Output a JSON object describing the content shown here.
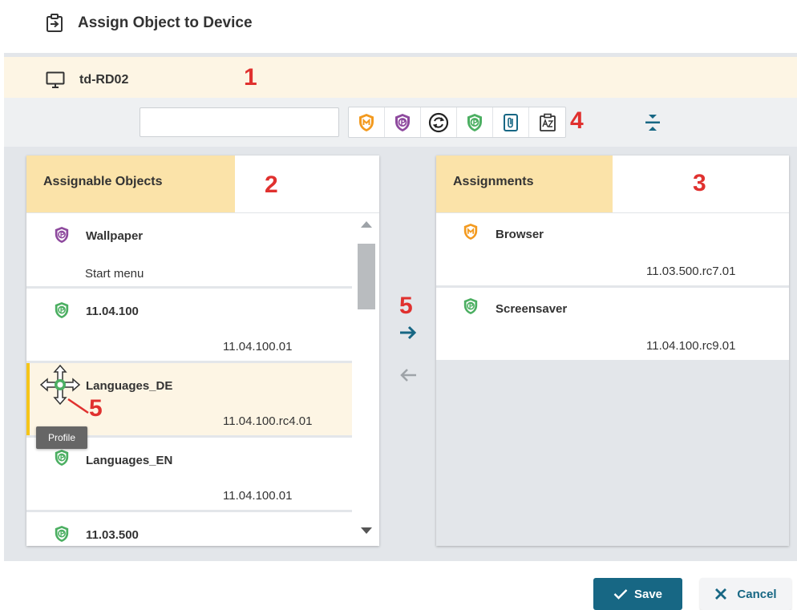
{
  "dialog": {
    "title": "Assign Object to Device"
  },
  "device": {
    "name": "td-RD02"
  },
  "search": {
    "value": "",
    "placeholder": ""
  },
  "filters": [
    {
      "icon": "orange-shield-icon"
    },
    {
      "icon": "purple-shield-icon"
    },
    {
      "icon": "sync-icon"
    },
    {
      "icon": "green-profile-shield-icon"
    },
    {
      "icon": "attachment-icon"
    },
    {
      "icon": "sort-az-icon"
    }
  ],
  "annotations": {
    "a1": "1",
    "a2": "2",
    "a3": "3",
    "a4": "4",
    "a5a": "5",
    "a5b": "5"
  },
  "left_panel": {
    "title": "Assignable Objects",
    "items": [
      {
        "name": "Wallpaper",
        "version": "",
        "subtitle": "Start menu",
        "icon": "purple-shield-icon"
      },
      {
        "name": "11.04.100",
        "version": "11.04.100.01",
        "icon": "green-profile-shield-icon"
      },
      {
        "name": "Languages_DE",
        "version": "11.04.100.rc4.01",
        "icon": "green-profile-shield-icon",
        "selected": true
      },
      {
        "name": "Languages_EN",
        "version": "11.04.100.01",
        "icon": "green-profile-shield-icon"
      },
      {
        "name": "11.03.500",
        "version": "",
        "icon": "green-profile-shield-icon"
      }
    ]
  },
  "right_panel": {
    "title": "Assignments",
    "items": [
      {
        "name": "Browser",
        "version": "11.03.500.rc7.01",
        "icon": "orange-shield-icon"
      },
      {
        "name": "Screensaver",
        "version": "11.04.100.rc9.01",
        "icon": "green-profile-shield-icon"
      }
    ]
  },
  "tooltip": {
    "text": "Profile"
  },
  "footer": {
    "save_label": "Save",
    "cancel_label": "Cancel"
  },
  "colors": {
    "accent": "#176784",
    "highlight": "#fbe3a9",
    "selected_bg": "#fdf5e4",
    "annotation": "#e0312f"
  }
}
